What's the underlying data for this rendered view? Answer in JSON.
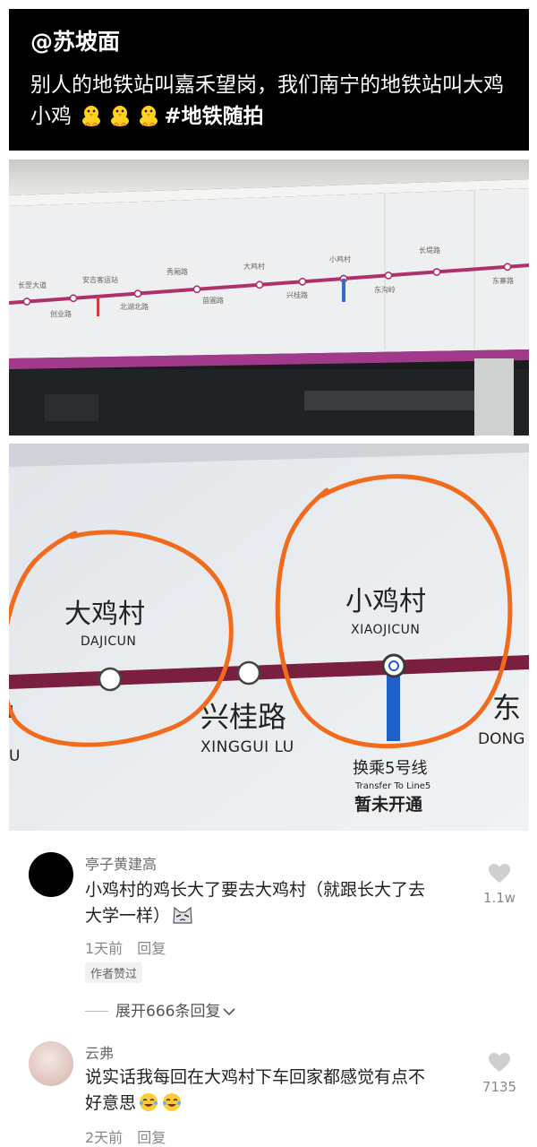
{
  "post": {
    "handle": "@苏坡面",
    "text": "别人的地铁站叫嘉禾望岗，我们南宁的地铁站叫大鸡小鸡",
    "hashtag": "#地铁随拍",
    "emoji_count": 3,
    "emoji": "baby-chick"
  },
  "overview_map": {
    "line_color": "#b0306c",
    "stations_top": [
      "长罡大道",
      "安吉客运站",
      "秀厢路",
      "大鸡村",
      "小鸡村",
      "长堤路"
    ],
    "stations_bottom": [
      "创业路",
      "北湖北路",
      "苗圃路",
      "兴桂路",
      "东沟岭",
      "东寨路"
    ]
  },
  "closeup_map": {
    "line_color": "#7a1f40",
    "transfer_color": "#1f5fc8",
    "highlight_color": "#f26a1b",
    "station_dajicun": {
      "cn": "大鸡村",
      "en": "DAJICUN"
    },
    "station_xiaojicun": {
      "cn": "小鸡村",
      "en": "XIAOJICUN"
    },
    "station_xingguilu": {
      "cn": "兴桂路",
      "en": "XINGGUI LU"
    },
    "station_edge_cn": "东",
    "station_edge_en": "DONG",
    "left_edge_en": "U",
    "transfer": {
      "cn": "换乘5号线",
      "en": "Transfer To Line5",
      "notice": "暂未开通"
    }
  },
  "comments": [
    {
      "user": "亭子黄建高",
      "text_line1": "小鸡村的鸡长大了要去大鸡村（就跟长大了去",
      "text_line2": "大学一样）",
      "time": "1天前",
      "reply": "回复",
      "likes": "1.1w",
      "author_liked": "作者赞过",
      "expand": "展开666条回复",
      "expand_icon": "chevron-down",
      "avatar_color": "#000000"
    },
    {
      "user": "云弗",
      "text_line1": "说实话我每回在大鸡村下车回家都感觉有点不",
      "text_line2": "好意思",
      "time": "2天前",
      "reply": "回复",
      "likes": "7135",
      "avatar_color": "#e8d6d2"
    }
  ]
}
